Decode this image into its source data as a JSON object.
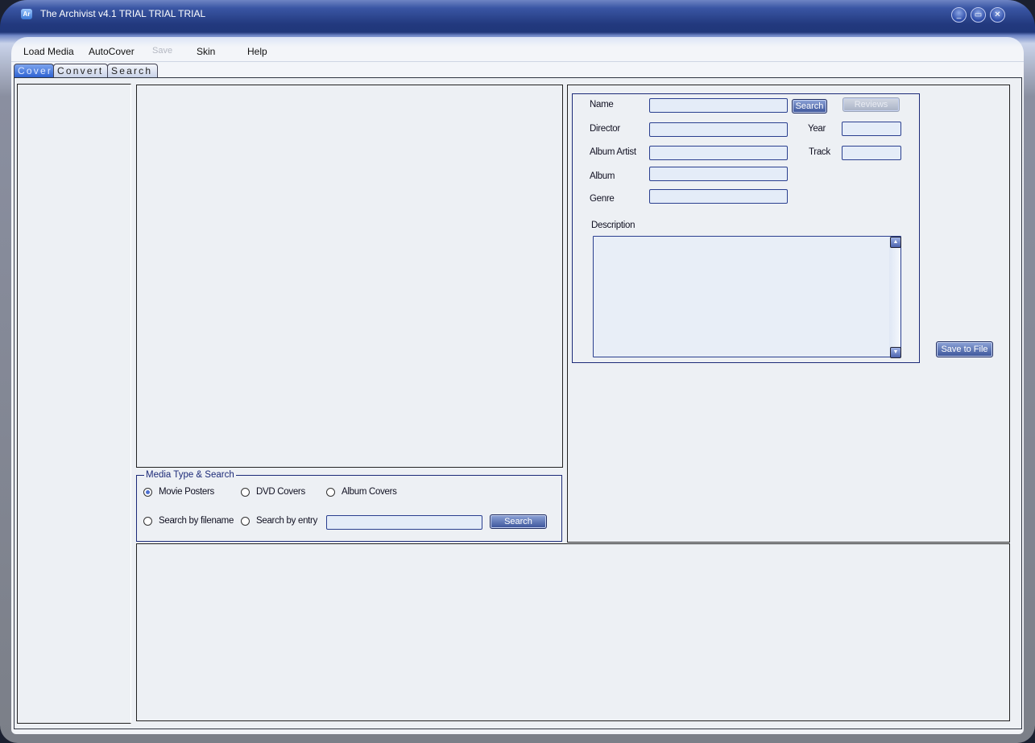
{
  "window": {
    "title": "The Archivist  v4.1  TRIAL  TRIAL  TRIAL",
    "icon": "app-icon",
    "controls": {
      "minimize": "_",
      "maximize": "▭",
      "close": "✕"
    }
  },
  "menubar": {
    "items": [
      {
        "label": "Load Media",
        "enabled": true
      },
      {
        "label": "AutoCover",
        "enabled": true
      },
      {
        "label": "Save",
        "enabled": false
      },
      {
        "label": "Skin",
        "enabled": true
      },
      {
        "label": "Help",
        "enabled": true
      }
    ]
  },
  "tabs": [
    {
      "label": "Cover",
      "active": true
    },
    {
      "label": "Convert",
      "active": false
    },
    {
      "label": "Search",
      "active": false
    }
  ],
  "info": {
    "fields": {
      "name": {
        "label": "Name",
        "value": ""
      },
      "director": {
        "label": "Director",
        "value": ""
      },
      "album_artist": {
        "label": "Album Artist",
        "value": ""
      },
      "album": {
        "label": "Album",
        "value": ""
      },
      "genre": {
        "label": "Genre",
        "value": ""
      },
      "year": {
        "label": "Year",
        "value": ""
      },
      "track": {
        "label": "Track",
        "value": ""
      }
    },
    "search_button": "Search",
    "reviews_button": "Reviews",
    "description_label": "Description",
    "description_value": "",
    "save_to_file_button": "Save to File"
  },
  "media_search": {
    "legend": "Media Type & Search",
    "media_types": [
      {
        "label": "Movie Posters",
        "selected": true
      },
      {
        "label": "DVD Covers",
        "selected": false
      },
      {
        "label": "Album Covers",
        "selected": false
      }
    ],
    "search_modes": [
      {
        "label": "Search by filename",
        "selected": false
      },
      {
        "label": "Search by entry",
        "selected": false
      }
    ],
    "search_value": "",
    "search_button": "Search"
  }
}
